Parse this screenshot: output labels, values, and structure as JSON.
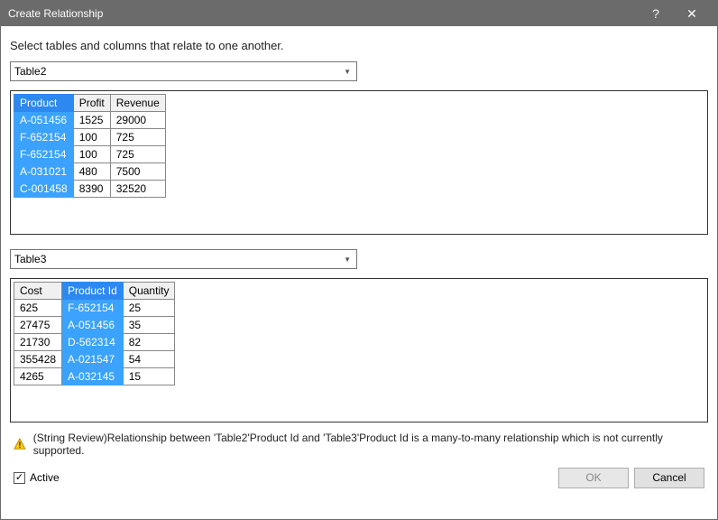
{
  "titlebar": {
    "title": "Create Relationship",
    "help": "?",
    "close": "✕"
  },
  "instruction": "Select tables and columns that relate to one another.",
  "dropdown1": {
    "value": "Table2"
  },
  "dropdown2": {
    "value": "Table3"
  },
  "table1": {
    "selected_col_index": 0,
    "headers": [
      "Product",
      "Profit",
      "Revenue"
    ],
    "rows": [
      [
        "A-051456",
        "1525",
        "29000"
      ],
      [
        "F-652154",
        "100",
        "725"
      ],
      [
        "F-652154",
        "100",
        "725"
      ],
      [
        "A-031021",
        "480",
        "7500"
      ],
      [
        "C-001458",
        "8390",
        "32520"
      ]
    ]
  },
  "table2": {
    "selected_col_index": 1,
    "headers": [
      "Cost",
      "Product Id",
      "Quantity"
    ],
    "rows": [
      [
        "625",
        "F-652154",
        "25"
      ],
      [
        "27475",
        "A-051456",
        "35"
      ],
      [
        "21730",
        "D-562314",
        "82"
      ],
      [
        "355428",
        "A-021547",
        "54"
      ],
      [
        "4265",
        "A-032145",
        "15"
      ]
    ]
  },
  "warning": "(String Review)Relationship between 'Table2'Product Id and 'Table3'Product Id is a many-to-many relationship which is not currently supported.",
  "footer": {
    "active_label": "Active",
    "active_checked": true,
    "ok": "OK",
    "cancel": "Cancel"
  }
}
